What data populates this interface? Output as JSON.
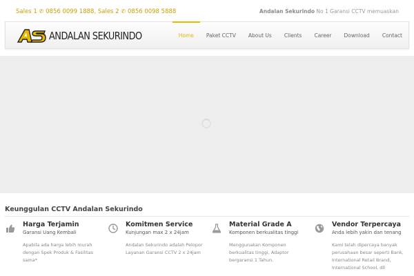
{
  "topbar": {
    "sales1_label": "Sales 1",
    "sales1_phone": "0856 0099 1888",
    "sales2_label": "Sales 2",
    "sales2_phone": "0856 0098 5888",
    "brand": "Andalan Sekurindo",
    "slogan": "No 1 Garansi CCTV memuaskan"
  },
  "logo": {
    "mark": "AS",
    "text": "ANDALAN SEKURINDO"
  },
  "nav": {
    "items": [
      {
        "label": "Home",
        "active": true
      },
      {
        "label": "Paket CCTV",
        "active": false
      },
      {
        "label": "About Us",
        "active": false
      },
      {
        "label": "Clients",
        "active": false
      },
      {
        "label": "Career",
        "active": false
      },
      {
        "label": "Download",
        "active": false
      },
      {
        "label": "Contact",
        "active": false
      }
    ]
  },
  "section": {
    "title": "Keunggulan CCTV Andalan Sekurindo"
  },
  "features": [
    {
      "icon": "thumbs-up-icon",
      "title": "Harga Terjamin",
      "subtitle": "Garansi Uang Kembali",
      "description": "Apabila ada harga lebih murah dengan Spek Produk & Fasilitas sama*"
    },
    {
      "icon": "clock-icon",
      "title": "Komitmen Service",
      "subtitle": "Kunjungan max 2 x 24jam",
      "description": "Andalan Sekurindo adalah Pelopor Layanan Garansi CCTV 2 x 24jam"
    },
    {
      "icon": "flask-icon",
      "title": "Material Grade A",
      "subtitle": "Komponen berkualitas tinggi",
      "description": "Menggunakan Komponen berkualitas tinggi, Adaptor bergaransi 1 Tahun."
    },
    {
      "icon": "globe-icon",
      "title": "Vendor Terpercaya",
      "subtitle": "Anda lebih yakin dan tenang",
      "description": "Kami telah dipercaya banyak perusahaan besar seperti Bank, International Retail Brand, International School, dll"
    }
  ],
  "colors": {
    "accent": "#e6b800",
    "sales_text": "#c8a000",
    "hero_bg": "#eeeeee"
  }
}
